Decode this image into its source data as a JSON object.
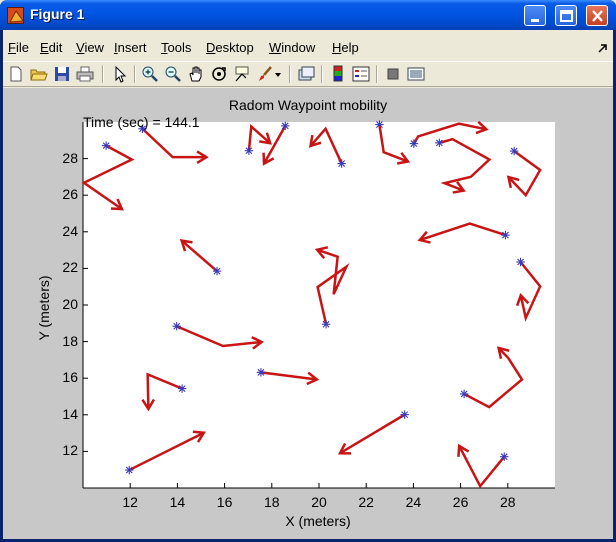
{
  "window": {
    "title": "Figure 1",
    "controls": [
      "minimize",
      "maximize",
      "close"
    ]
  },
  "menu": {
    "items": [
      {
        "label": "File",
        "u": "F",
        "rest": "ile"
      },
      {
        "label": "Edit",
        "u": "E",
        "rest": "dit"
      },
      {
        "label": "View",
        "u": "V",
        "rest": "iew"
      },
      {
        "label": "Insert",
        "u": "I",
        "rest": "nsert"
      },
      {
        "label": "Tools",
        "u": "T",
        "rest": "ools"
      },
      {
        "label": "Desktop",
        "u": "D",
        "rest": "esktop"
      },
      {
        "label": "Window",
        "u": "W",
        "rest": "indow"
      },
      {
        "label": "Help",
        "u": "H",
        "rest": "elp"
      }
    ]
  },
  "toolbar": {
    "tools": [
      "new-figure-icon",
      "open-file-icon",
      "save-icon",
      "print-icon",
      "edit-plot-arrow-icon",
      "zoom-in-icon",
      "zoom-out-icon",
      "pan-hand-icon",
      "rotate-3d-icon",
      "data-cursor-icon",
      "brush-icon",
      "brush-dropdown-icon",
      "link-plot-icon",
      "colorbar-icon",
      "legend-icon",
      "hide-plot-tools-icon",
      "show-plot-tools-icon"
    ]
  },
  "figure": {
    "title": "Radom Waypoint mobility",
    "time_text": "Time (sec) = 144.1"
  },
  "chart_data": {
    "type": "scatter",
    "title": "Radom Waypoint mobility",
    "xlabel": "X (meters)",
    "ylabel": "Y (meters)",
    "xlim": [
      10,
      30
    ],
    "ylim": [
      10,
      30
    ],
    "xticks": [
      "12",
      "14",
      "16",
      "18",
      "20",
      "22",
      "24",
      "26",
      "28"
    ],
    "yticks": [
      "12",
      "14",
      "16",
      "18",
      "20",
      "22",
      "24",
      "26",
      "28"
    ],
    "grid": false,
    "marker_color": "#3a3ab8",
    "arrow_color": "#c81414",
    "nodes": [
      {
        "x": 10.98,
        "y": 28.71,
        "path": [
          [
            10.98,
            28.71
          ],
          [
            12.07,
            27.95
          ],
          [
            10.04,
            26.68
          ],
          [
            11.65,
            25.24
          ]
        ]
      },
      {
        "x": 12.52,
        "y": 29.63,
        "path": [
          [
            12.52,
            29.63
          ],
          [
            13.8,
            28.08
          ],
          [
            15.23,
            28.08
          ]
        ]
      },
      {
        "x": 17.03,
        "y": 28.43,
        "path": [
          [
            17.03,
            28.43
          ],
          [
            17.13,
            29.75
          ],
          [
            17.93,
            28.84
          ]
        ]
      },
      {
        "x": 18.57,
        "y": 29.79,
        "path": [
          [
            18.57,
            29.79
          ],
          [
            17.67,
            27.72
          ]
        ]
      },
      {
        "x": 20.96,
        "y": 27.73,
        "path": [
          [
            20.96,
            27.73
          ],
          [
            20.28,
            29.63
          ],
          [
            19.64,
            28.69
          ]
        ]
      },
      {
        "x": 22.56,
        "y": 29.86,
        "path": [
          [
            22.56,
            29.86
          ],
          [
            22.74,
            28.35
          ],
          [
            23.77,
            27.84
          ]
        ]
      },
      {
        "x": 24.02,
        "y": 28.82,
        "path": [
          [
            24.02,
            28.82
          ],
          [
            24.2,
            29.21
          ],
          [
            25.93,
            29.91
          ],
          [
            27.09,
            29.6
          ]
        ]
      },
      {
        "x": 25.1,
        "y": 28.86,
        "path": [
          [
            25.1,
            28.86
          ],
          [
            25.66,
            29.06
          ],
          [
            27.22,
            27.95
          ],
          [
            26.43,
            27.0
          ],
          [
            25.32,
            26.66
          ],
          [
            26.13,
            26.25
          ]
        ]
      },
      {
        "x": 28.27,
        "y": 28.41,
        "path": [
          [
            28.27,
            28.41
          ],
          [
            29.37,
            27.38
          ],
          [
            28.76,
            26.0
          ],
          [
            28.03,
            26.99
          ]
        ]
      },
      {
        "x": 27.9,
        "y": 23.82,
        "path": [
          [
            27.9,
            23.82
          ],
          [
            26.39,
            24.45
          ],
          [
            24.27,
            23.55
          ]
        ]
      },
      {
        "x": 15.68,
        "y": 21.85,
        "path": [
          [
            15.68,
            21.85
          ],
          [
            14.18,
            23.52
          ]
        ]
      },
      {
        "x": 20.3,
        "y": 18.95,
        "path": [
          [
            20.3,
            18.95
          ],
          [
            19.94,
            20.98
          ],
          [
            21.16,
            22.09
          ],
          [
            20.62,
            20.59
          ],
          [
            20.79,
            22.64
          ],
          [
            19.92,
            23.02
          ]
        ]
      },
      {
        "x": 28.54,
        "y": 22.35,
        "path": [
          [
            28.54,
            22.35
          ],
          [
            29.37,
            21.02
          ],
          [
            28.76,
            19.29
          ],
          [
            28.55,
            20.53
          ]
        ]
      },
      {
        "x": 13.97,
        "y": 18.84,
        "path": [
          [
            13.97,
            18.84
          ],
          [
            15.93,
            17.76
          ],
          [
            17.57,
            17.98
          ]
        ]
      },
      {
        "x": 17.54,
        "y": 16.32,
        "path": [
          [
            17.54,
            16.32
          ],
          [
            19.91,
            15.93
          ]
        ]
      },
      {
        "x": 14.2,
        "y": 15.43,
        "path": [
          [
            14.2,
            15.43
          ],
          [
            12.74,
            16.21
          ],
          [
            12.77,
            14.32
          ]
        ]
      },
      {
        "x": 26.15,
        "y": 15.14,
        "path": [
          [
            26.15,
            15.14
          ],
          [
            27.21,
            14.42
          ],
          [
            28.6,
            15.93
          ],
          [
            28.02,
            17.1
          ],
          [
            27.61,
            17.65
          ]
        ]
      },
      {
        "x": 23.63,
        "y": 14.01,
        "path": [
          [
            23.63,
            14.01
          ],
          [
            20.89,
            11.9
          ]
        ]
      },
      {
        "x": 11.96,
        "y": 10.98,
        "path": [
          [
            11.96,
            10.98
          ],
          [
            15.12,
            13.02
          ]
        ]
      },
      {
        "x": 27.85,
        "y": 11.71,
        "path": [
          [
            27.85,
            11.71
          ],
          [
            26.83,
            10.1
          ],
          [
            25.94,
            12.3
          ]
        ]
      }
    ]
  }
}
